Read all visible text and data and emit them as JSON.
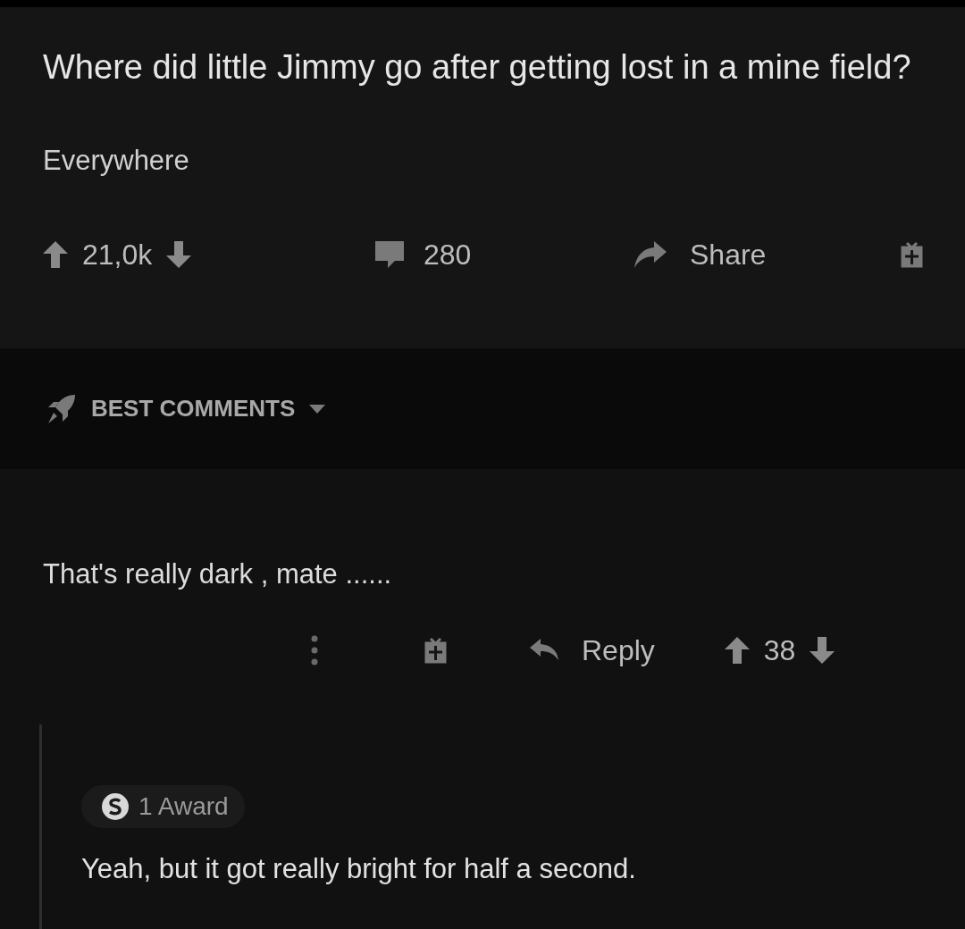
{
  "post": {
    "title": "Where did little Jimmy go after getting lost in a mine field?",
    "body": "Everywhere",
    "score": "21,0k",
    "comments": "280",
    "share": "Share"
  },
  "sort": {
    "label": "BEST COMMENTS"
  },
  "comments": [
    {
      "text": "That's really dark , mate ......",
      "reply": "Reply",
      "score": "38",
      "children": [
        {
          "award": "1 Award",
          "text": "Yeah, but it got really bright for half a second."
        }
      ]
    }
  ]
}
